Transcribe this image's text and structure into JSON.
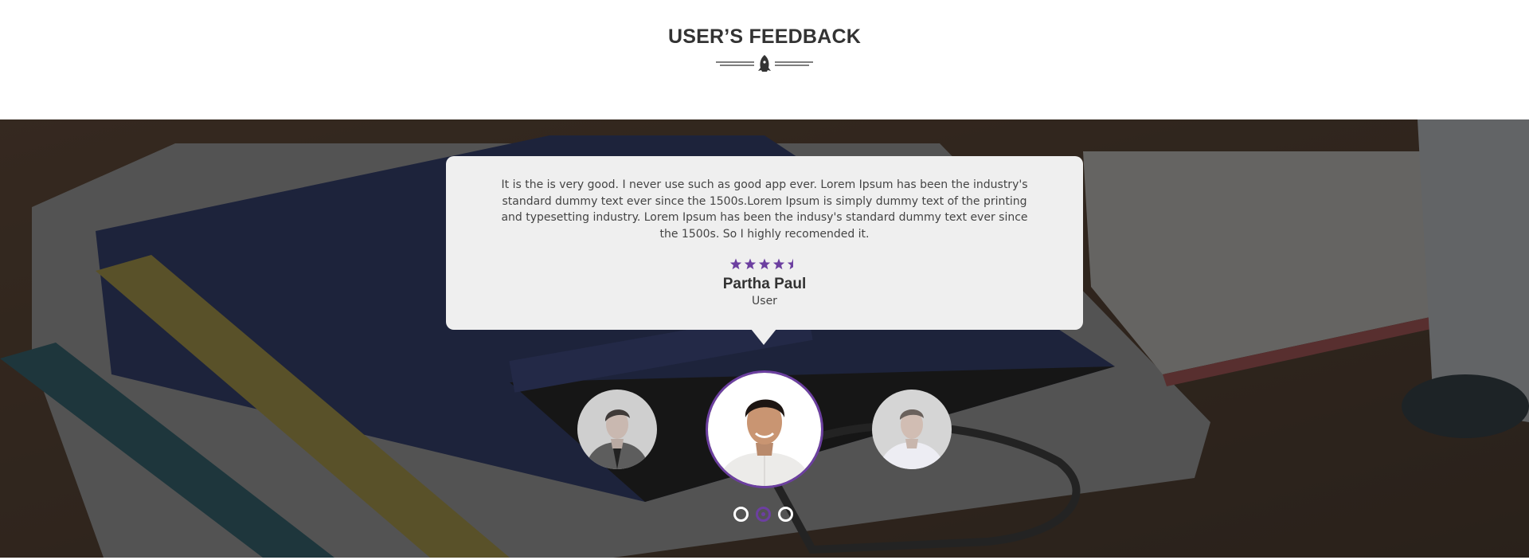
{
  "section": {
    "title": "USER’S FEEDBACK"
  },
  "testimonial": {
    "quote": "It is the is very good. I never use such as good app ever. Lorem Ipsum has been the industry's standard dummy text ever since the 1500s.Lorem Ipsum is simply dummy text of the printing and typesetting industry. Lorem Ipsum has been the indusy's standard dummy text ever since the 1500s. So I highly recomended it.",
    "rating": 4.5,
    "rating_max": 5,
    "name": "Partha Paul",
    "role": "User"
  },
  "slider": {
    "slide_count": 3,
    "active_index": 1
  },
  "icons": {
    "divider": "rocket-icon",
    "star": "star-icon"
  },
  "colors": {
    "accent": "#6c3fa0",
    "card_bg": "#efefef",
    "heading": "#333333",
    "overlay": "#3a3a3a"
  }
}
